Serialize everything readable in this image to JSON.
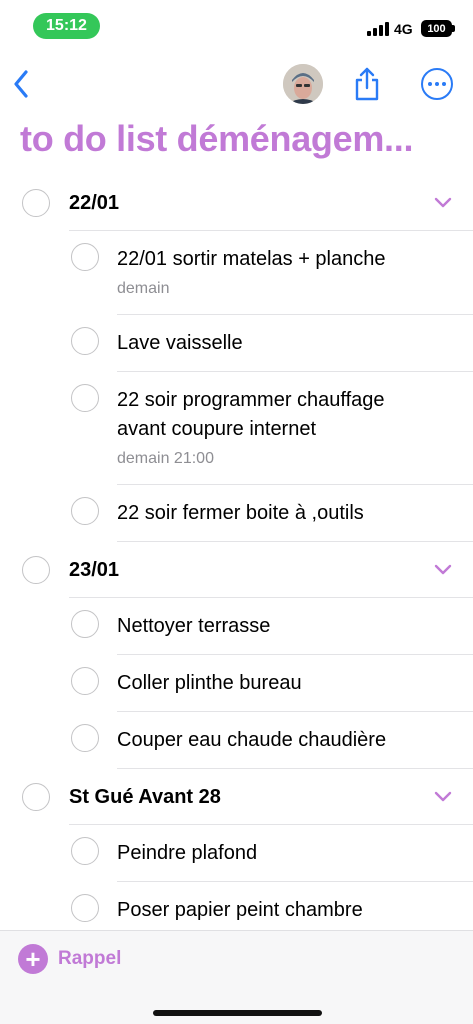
{
  "status_bar": {
    "time": "15:12",
    "network": "4G",
    "battery": "100"
  },
  "nav": {
    "back_icon": "chevron-left-icon",
    "share_icon": "share-icon",
    "more_icon": "ellipsis-circle-icon",
    "accent_color": "#2a7bf6"
  },
  "list": {
    "title": "to do list déménagem...",
    "color": "#c17ad6",
    "groups": [
      {
        "title": "22/01",
        "tasks": [
          {
            "text": "22/01 sortir matelas + planche",
            "sub": "demain"
          },
          {
            "text": "Lave vaisselle",
            "sub": ""
          },
          {
            "text": "22 soir programmer chauffage avant coupure internet",
            "sub": "demain 21:00"
          },
          {
            "text": "22 soir fermer boite à ,outils",
            "sub": ""
          }
        ]
      },
      {
        "title": "23/01",
        "tasks": [
          {
            "text": "Nettoyer terrasse",
            "sub": ""
          },
          {
            "text": "Coller plinthe bureau",
            "sub": ""
          },
          {
            "text": "Couper eau chaude chaudière",
            "sub": ""
          }
        ]
      },
      {
        "title": "St Gué Avant 28",
        "tasks": [
          {
            "text": "Peindre plafond",
            "sub": ""
          },
          {
            "text": "Poser papier peint chambre",
            "sub": ""
          }
        ]
      }
    ]
  },
  "footer": {
    "add_label": "Rappel",
    "add_icon": "plus-circle-icon"
  }
}
